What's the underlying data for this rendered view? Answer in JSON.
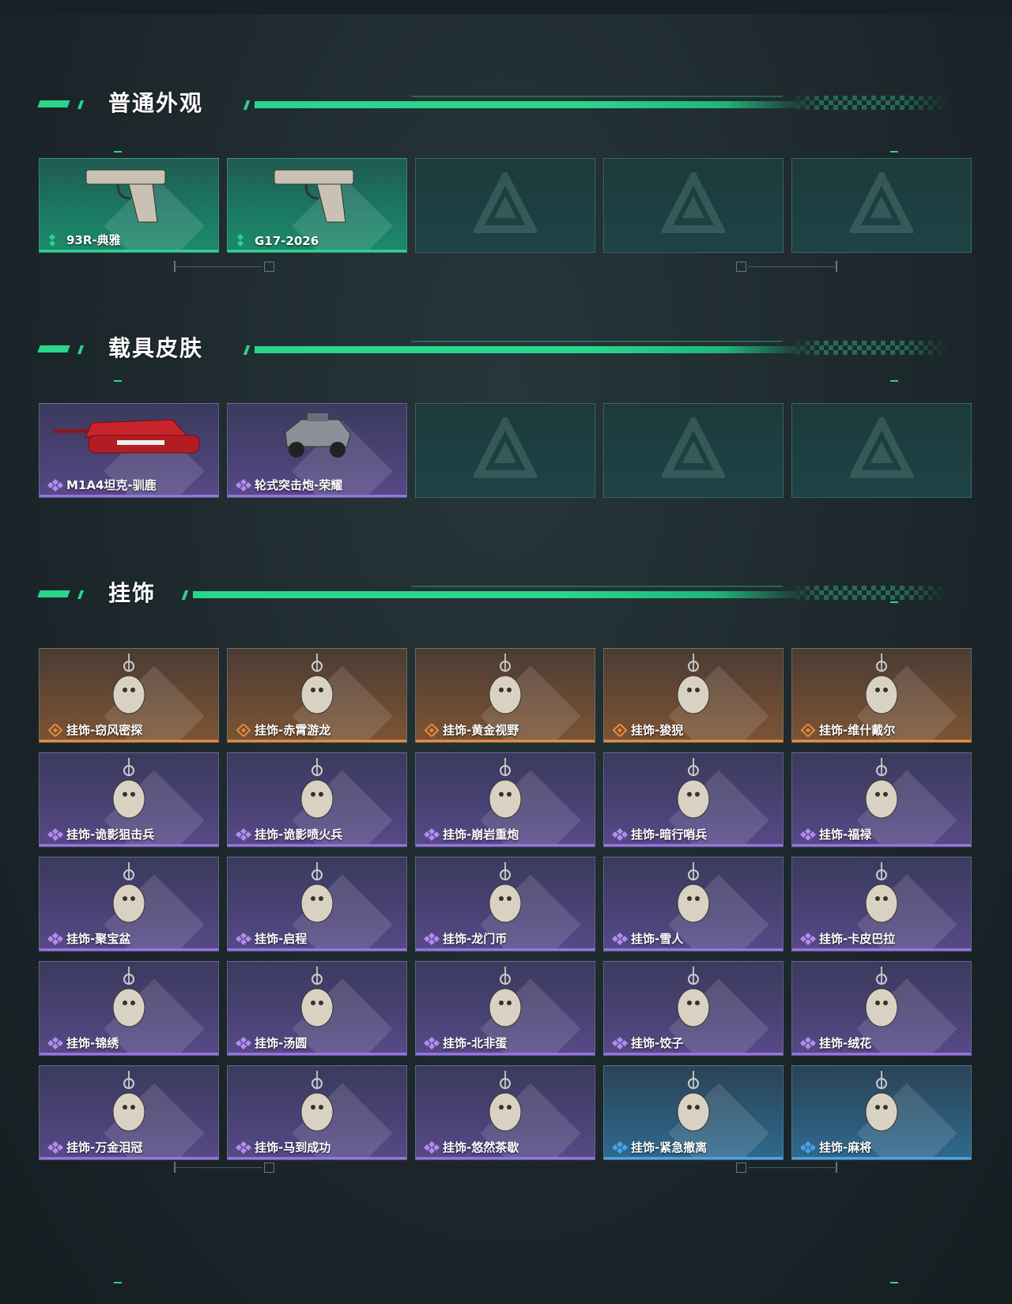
{
  "colors": {
    "accent": "#2bd58c",
    "purple": "#9a70e8",
    "orange": "#e88b3c",
    "blue": "#4aa3ea"
  },
  "sections": [
    {
      "title": "普通外观",
      "items": [
        {
          "label": "93R-典雅",
          "rarity": "green",
          "icon": "pistol-icon"
        },
        {
          "label": "G17-2026",
          "rarity": "green",
          "icon": "pistol-icon"
        },
        {
          "label": "",
          "rarity": "empty"
        },
        {
          "label": "",
          "rarity": "empty"
        },
        {
          "label": "",
          "rarity": "empty"
        }
      ]
    },
    {
      "title": "载具皮肤",
      "items": [
        {
          "label": "M1A4坦克-驯鹿",
          "rarity": "purple",
          "icon": "tank-icon"
        },
        {
          "label": "轮式突击炮-荣耀",
          "rarity": "purple",
          "icon": "armored-car-icon"
        },
        {
          "label": "",
          "rarity": "empty"
        },
        {
          "label": "",
          "rarity": "empty"
        },
        {
          "label": "",
          "rarity": "empty"
        }
      ]
    },
    {
      "title": "挂饰",
      "items": [
        {
          "label": "挂饰-窃风密探",
          "rarity": "orange",
          "icon": "charm-icon"
        },
        {
          "label": "挂饰-赤霄游龙",
          "rarity": "orange",
          "icon": "charm-icon"
        },
        {
          "label": "挂饰-黄金视野",
          "rarity": "orange",
          "icon": "charm-icon"
        },
        {
          "label": "挂饰-狻猊",
          "rarity": "orange",
          "icon": "charm-icon"
        },
        {
          "label": "挂饰-维什戴尔",
          "rarity": "orange",
          "icon": "charm-icon"
        },
        {
          "label": "挂饰-诡影狙击兵",
          "rarity": "purple",
          "icon": "charm-icon"
        },
        {
          "label": "挂饰-诡影喷火兵",
          "rarity": "purple",
          "icon": "charm-icon"
        },
        {
          "label": "挂饰-崩岩重炮",
          "rarity": "purple",
          "icon": "charm-icon"
        },
        {
          "label": "挂饰-暗行哨兵",
          "rarity": "purple",
          "icon": "charm-icon"
        },
        {
          "label": "挂饰-福禄",
          "rarity": "purple",
          "icon": "charm-icon"
        },
        {
          "label": "挂饰-聚宝盆",
          "rarity": "purple",
          "icon": "charm-icon"
        },
        {
          "label": "挂饰-启程",
          "rarity": "purple",
          "icon": "charm-icon"
        },
        {
          "label": "挂饰-龙门币",
          "rarity": "purple",
          "icon": "charm-icon"
        },
        {
          "label": "挂饰-雪人",
          "rarity": "purple",
          "icon": "charm-icon"
        },
        {
          "label": "挂饰-卡皮巴拉",
          "rarity": "purple",
          "icon": "charm-icon"
        },
        {
          "label": "挂饰-锦绣",
          "rarity": "purple",
          "icon": "charm-icon"
        },
        {
          "label": "挂饰-汤圆",
          "rarity": "purple",
          "icon": "charm-icon"
        },
        {
          "label": "挂饰-北非蛋",
          "rarity": "purple",
          "icon": "charm-icon"
        },
        {
          "label": "挂饰-饺子",
          "rarity": "purple",
          "icon": "charm-icon"
        },
        {
          "label": "挂饰-绒花",
          "rarity": "purple",
          "icon": "charm-icon"
        },
        {
          "label": "挂饰-万金泪冠",
          "rarity": "purple",
          "icon": "charm-icon"
        },
        {
          "label": "挂饰-马到成功",
          "rarity": "purple",
          "icon": "charm-icon"
        },
        {
          "label": "挂饰-悠然茶歇",
          "rarity": "purple",
          "icon": "charm-icon"
        },
        {
          "label": "挂饰-紧急撤离",
          "rarity": "blue",
          "icon": "charm-icon"
        },
        {
          "label": "挂饰-麻将",
          "rarity": "blue",
          "icon": "charm-icon"
        }
      ]
    }
  ]
}
